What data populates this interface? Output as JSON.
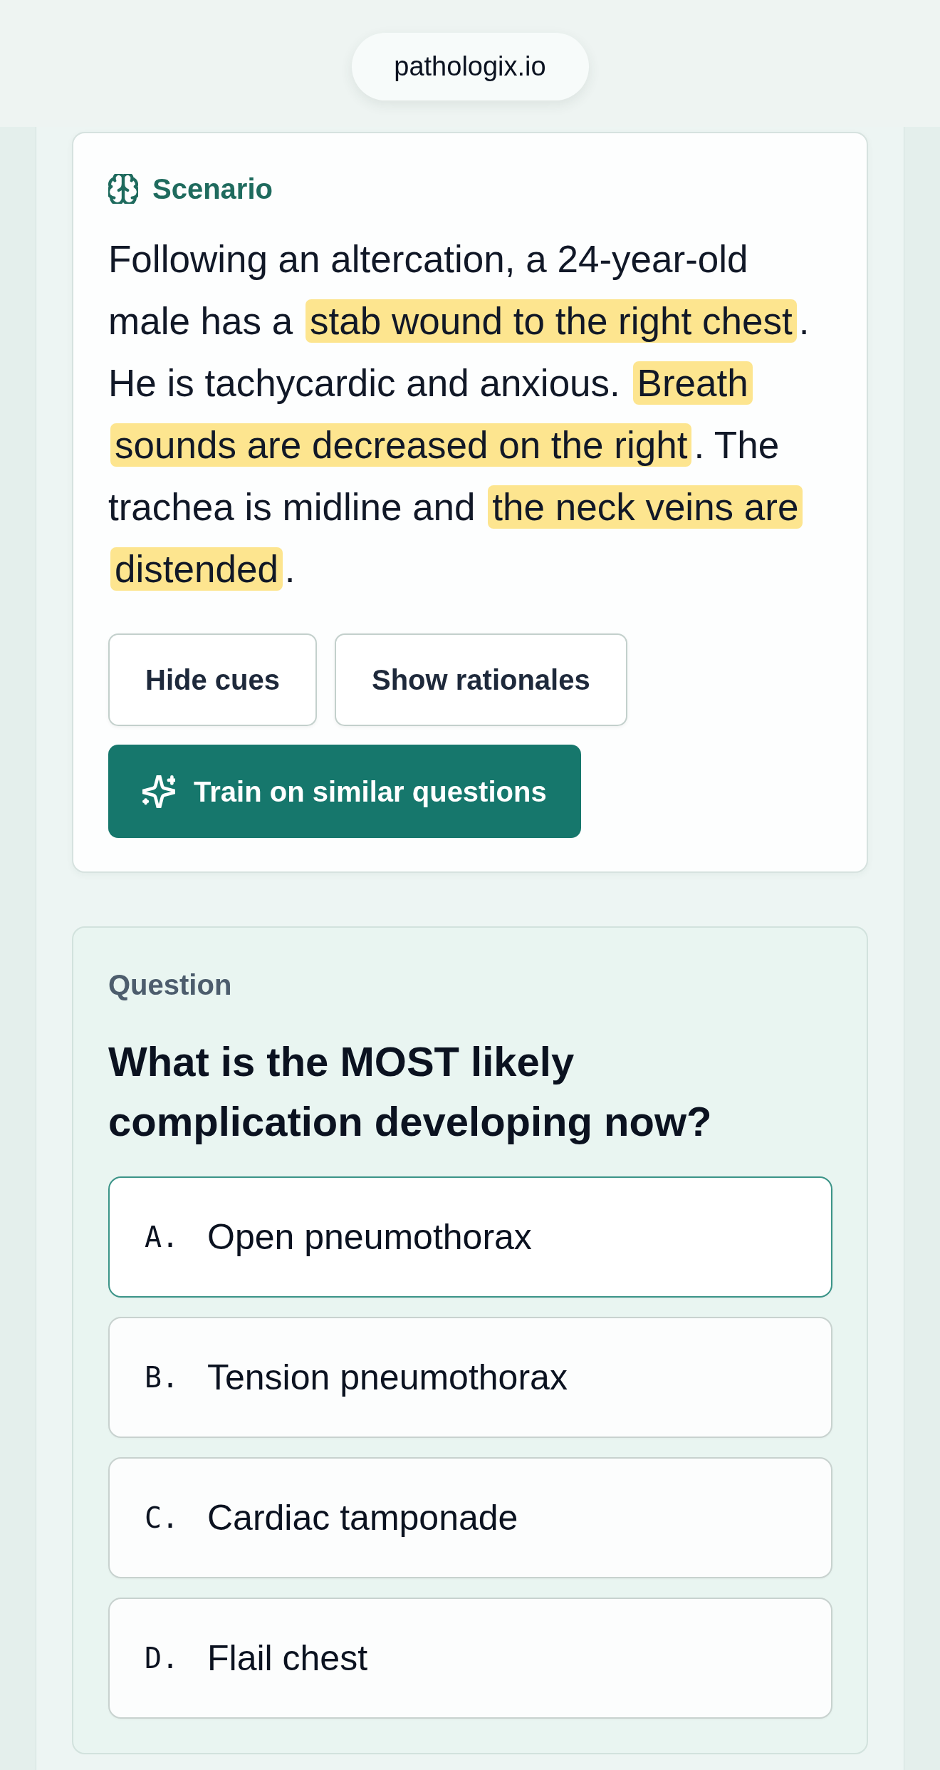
{
  "address_bar": {
    "url": "pathologix.io"
  },
  "scenario": {
    "title": "Scenario",
    "segments": [
      {
        "text": "Following an altercation, a 24-year-old male has a ",
        "highlighted": false
      },
      {
        "text": "stab wound to the right chest",
        "highlighted": true
      },
      {
        "text": ". He is tachycardic and anxious. ",
        "highlighted": false
      },
      {
        "text": "Breath sounds are decreased on the right",
        "highlighted": true
      },
      {
        "text": ". The trachea is midline and ",
        "highlighted": false
      },
      {
        "text": "the neck veins are distended",
        "highlighted": true
      },
      {
        "text": ".",
        "highlighted": false
      }
    ],
    "buttons": [
      {
        "label": "Hide cues",
        "kind": "outline"
      },
      {
        "label": "Show rationales",
        "kind": "outline"
      },
      {
        "label": "Train on similar questions",
        "kind": "primary"
      }
    ]
  },
  "question": {
    "label": "Question",
    "text": "What is the MOST likely complication developing now?",
    "options": [
      {
        "letter": "A.",
        "text": "Open pneumothorax",
        "selected": true
      },
      {
        "letter": "B.",
        "text": "Tension pneumothorax",
        "selected": false
      },
      {
        "letter": "C.",
        "text": "Cardiac tamponade",
        "selected": false
      },
      {
        "letter": "D.",
        "text": "Flail chest",
        "selected": false
      }
    ]
  }
}
